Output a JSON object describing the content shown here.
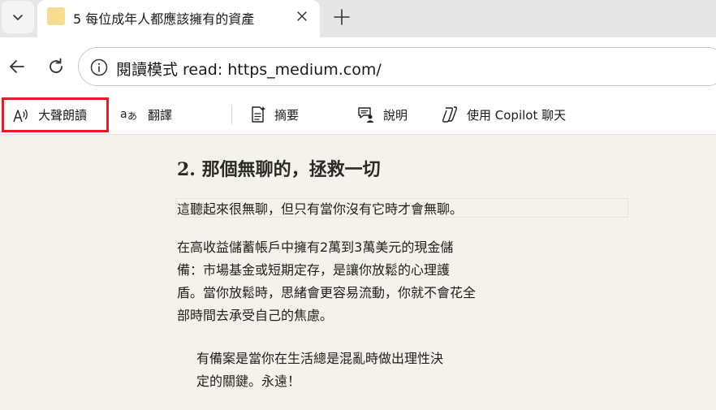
{
  "tab": {
    "title": "5 每位成年人都應該擁有的資產"
  },
  "address_bar": {
    "url_text": "閱讀模式 read: https_medium.com/"
  },
  "toolbar": {
    "read_aloud_label": "大聲朗讀",
    "translate_label": "翻譯",
    "summary_label": "摘要",
    "explain_label": "說明",
    "copilot_label": "使用 Copilot 聊天"
  },
  "article": {
    "heading": "2. 那個無聊的，拯救一切",
    "paragraph1": "這聽起來很無聊，但只有當你沒有它時才會無聊。",
    "paragraph2_lines": [
      "在高收益儲蓄帳戶中擁有2萬到3萬美元的現金儲",
      "備：市場基金或短期定存，是讓你放鬆的心理護",
      "盾。當你放鬆時，思緒會更容易流動，你就不會花全",
      "部時間去承受自己的焦慮。"
    ],
    "quote_lines": [
      "有備案是當你在生活總是混亂時做出理性決",
      "定的關鍵。永遠！"
    ]
  },
  "colors": {
    "page_background": "#f4f2ea",
    "highlight_border": "#e41e26",
    "tab_strip": "#e6e6e6"
  }
}
